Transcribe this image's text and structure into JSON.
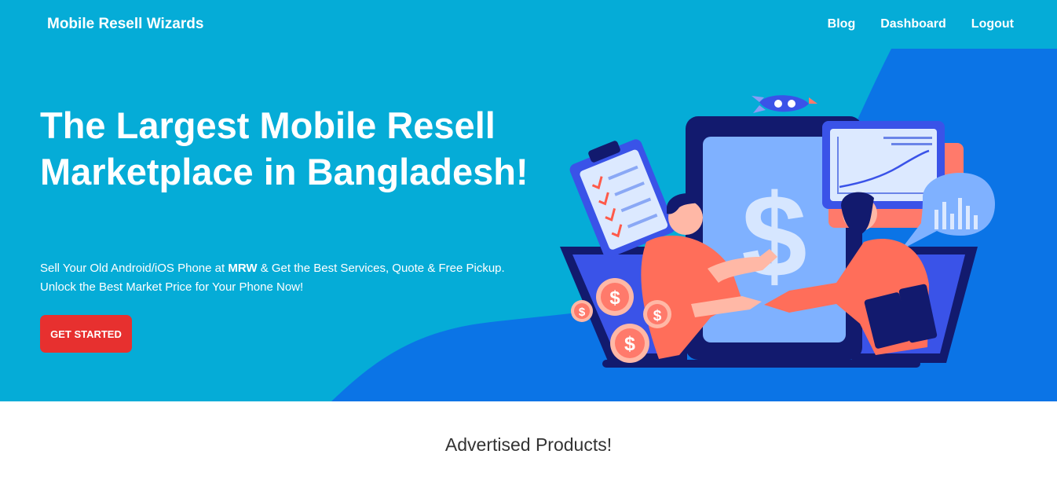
{
  "navbar": {
    "brand": "Mobile Resell Wizards",
    "links": [
      "Blog",
      "Dashboard",
      "Logout"
    ]
  },
  "hero": {
    "title": "The Largest Mobile Resell Marketplace in Bangladesh!",
    "subtitle_before": "Sell Your Old Android/iOS Phone at ",
    "subtitle_bold": "MRW",
    "subtitle_after": " & Get the Best Services, Quote & Free Pickup. Unlock the Best Market Price for Your Phone Now!",
    "cta_label": "GET STARTED",
    "illustration_icon": "handshake-deal-illustration"
  },
  "section": {
    "title": "Advertised Products!"
  },
  "colors": {
    "hero_bg": "#05acd7",
    "hero_wave": "#0b74e6",
    "cta_bg": "#e7302f",
    "text_dark": "#333333"
  }
}
